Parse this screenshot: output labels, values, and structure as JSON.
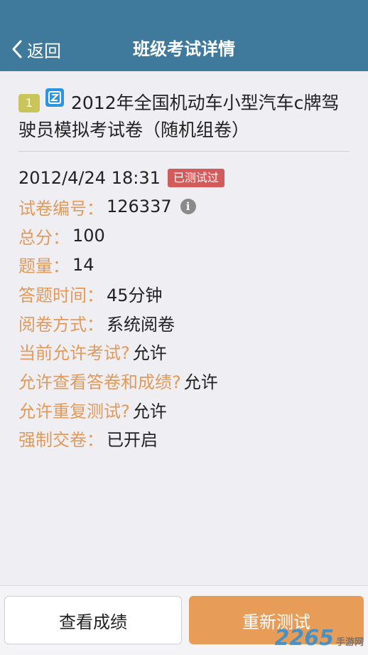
{
  "nav": {
    "back_label": "返回",
    "title": "班级考试详情"
  },
  "exam": {
    "index_badge": "1",
    "type_badge_icon": "document-icon",
    "title": "2012年全国机动车小型汽车c牌驾驶员模拟考试卷（随机组卷）",
    "datetime": "2012/4/24 18:31",
    "status": "已测试过",
    "fields": [
      {
        "label": "试卷编号：",
        "value": "126337"
      },
      {
        "label": "总分：",
        "value": "100"
      },
      {
        "label": "题量：",
        "value": "14"
      },
      {
        "label": "答题时间：",
        "value": "45分钟"
      },
      {
        "label": "阅卷方式：",
        "value": "系统阅卷"
      },
      {
        "label": "当前允许考试?",
        "value": "允许"
      },
      {
        "label": "允许查看答卷和成绩?",
        "value": "允许"
      },
      {
        "label": "允许重复测试?",
        "value": "允许"
      },
      {
        "label": "强制交卷：",
        "value": "已开启"
      }
    ]
  },
  "actions": {
    "view_score": "查看成绩",
    "retest": "重新测试"
  },
  "watermark": {
    "main": "2265",
    "sub": "手游网"
  },
  "colors": {
    "navbar": "#3f7a9c",
    "label": "#e09a5c",
    "status_tag": "#d35b5b",
    "retest_button": "#e79c58"
  }
}
